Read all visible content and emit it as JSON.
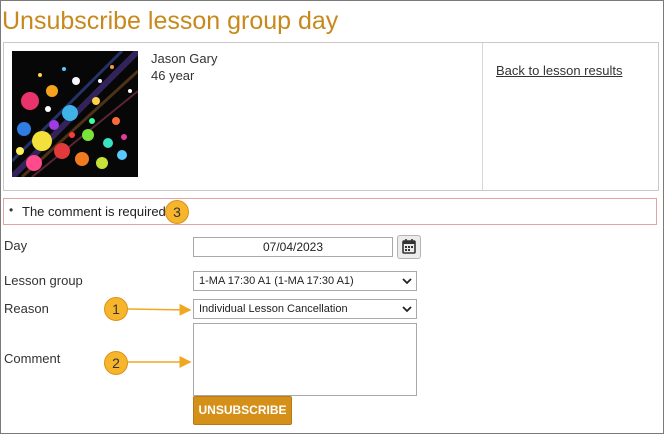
{
  "page": {
    "title": "Unsubscribe lesson group day"
  },
  "profile": {
    "name": "Jason Gary",
    "age": "46 year",
    "back_link": "Back to lesson results"
  },
  "errors": {
    "message": "The comment is required"
  },
  "callouts": {
    "one": "1",
    "two": "2",
    "three": "3"
  },
  "form": {
    "day": {
      "label": "Day",
      "value": "07/04/2023"
    },
    "lesson_group": {
      "label": "Lesson group",
      "selected": "1-MA 17:30 A1 (1-MA 17:30 A1)"
    },
    "reason": {
      "label": "Reason",
      "selected": "Individual Lesson Cancellation"
    },
    "comment": {
      "label": "Comment",
      "value": ""
    },
    "submit_label": "UNSUBSCRIBE"
  },
  "colors": {
    "accent": "#c8891c",
    "button": "#d5901a",
    "callout": "#f7b52c",
    "error_border": "#e2a3a6"
  },
  "icons": {
    "calendar": "calendar-icon",
    "dropdown": "chevron-down-icon"
  }
}
